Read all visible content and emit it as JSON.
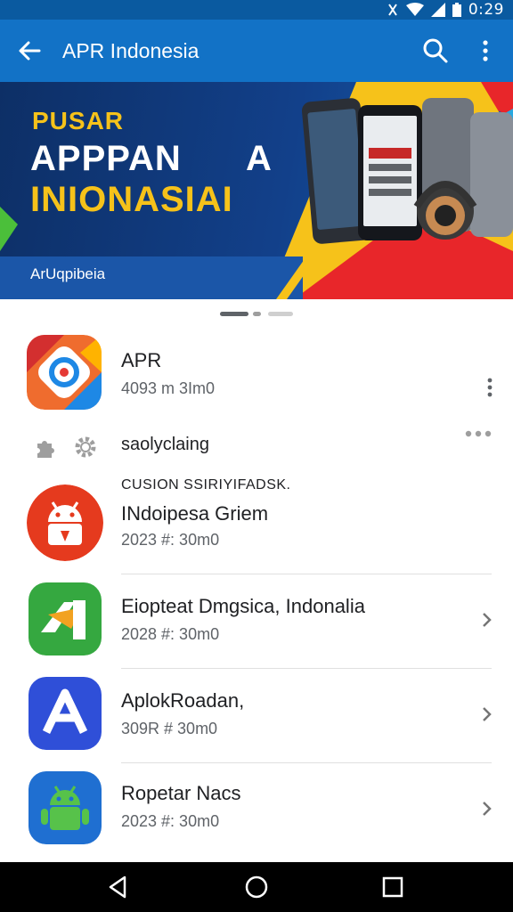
{
  "status_bar": {
    "time": "0:29"
  },
  "app_bar": {
    "title": "APR Indonesia"
  },
  "banner": {
    "line1": "PUSAR",
    "line2": "APPPAN",
    "line2_suffix": "A",
    "line3": "INIONASIAI",
    "subtitle": "ArUqpibeia"
  },
  "list": {
    "featured": {
      "title": "APR",
      "subtitle": "4093 m 3Im0"
    },
    "settings": {
      "label": "saolyclaing"
    },
    "section_label": "CUSION SSIRIYIFADSK.",
    "items": [
      {
        "title": "INdoipesa Griem",
        "subtitle": "2023 #: 30m0"
      },
      {
        "title": "Eiopteat Dmgsica, Indonalia",
        "subtitle": "2028 #: 30m0"
      },
      {
        "title": "AplokRoadan,",
        "subtitle": "309R # 30m0"
      },
      {
        "title": "Ropetar Nacs",
        "subtitle": "2023 #: 30m0"
      }
    ]
  },
  "colors": {
    "app_bar": "#1272c6",
    "status_bar": "#0a5aa0",
    "banner_yellow": "#f6c21a",
    "banner_red": "#e8262a",
    "banner_green": "#4bbf3a",
    "nav_bar": "#000000"
  },
  "icons": {
    "back": "arrow-left-icon",
    "search": "search-icon",
    "more": "more-vert-icon",
    "nav_back": "triangle-back-icon",
    "nav_home": "circle-home-icon",
    "nav_recents": "square-recents-icon"
  }
}
